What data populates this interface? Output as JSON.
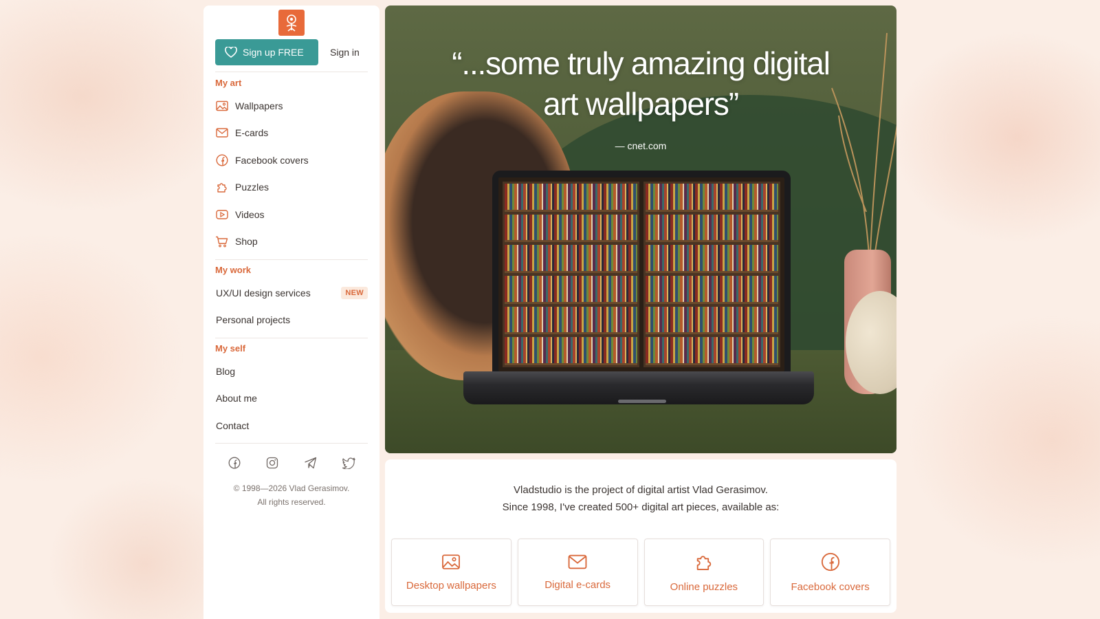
{
  "brand": {
    "accent": "#d9683a",
    "teal": "#3a9a96"
  },
  "auth": {
    "signup_label": "Sign up FREE",
    "signin_label": "Sign in"
  },
  "sidebar": {
    "my_art_title": "My art",
    "my_art_items": [
      {
        "label": "Wallpapers",
        "icon": "image-icon"
      },
      {
        "label": "E-cards",
        "icon": "envelope-icon"
      },
      {
        "label": "Facebook covers",
        "icon": "facebook-icon"
      },
      {
        "label": "Puzzles",
        "icon": "puzzle-icon"
      },
      {
        "label": "Videos",
        "icon": "video-icon"
      },
      {
        "label": "Shop",
        "icon": "cart-icon"
      }
    ],
    "my_work_title": "My work",
    "my_work_items": [
      {
        "label": "UX/UI design services",
        "badge": "NEW"
      },
      {
        "label": "Personal projects"
      }
    ],
    "my_self_title": "My self",
    "my_self_items": [
      {
        "label": "Blog"
      },
      {
        "label": "About me"
      },
      {
        "label": "Contact"
      }
    ],
    "social": [
      "facebook-icon",
      "instagram-icon",
      "telegram-icon",
      "twitter-icon"
    ],
    "copyright_line1": "© 1998—2026 Vlad Gerasimov.",
    "copyright_line2": "All rights reserved."
  },
  "hero": {
    "quote_line1": "“...some truly amazing digital",
    "quote_line2": "art wallpapers”",
    "source": "— cnet.com"
  },
  "info": {
    "line1": "Vladstudio is the project of digital artist Vlad Gerasimov.",
    "line2": "Since 1998, I've created 500+ digital art pieces, available as:",
    "cards": [
      {
        "label": "Desktop wallpapers",
        "icon": "image-icon"
      },
      {
        "label": "Digital e-cards",
        "icon": "envelope-icon"
      },
      {
        "label": "Online puzzles",
        "icon": "puzzle-icon"
      },
      {
        "label": "Facebook covers",
        "icon": "facebook-icon"
      }
    ]
  }
}
